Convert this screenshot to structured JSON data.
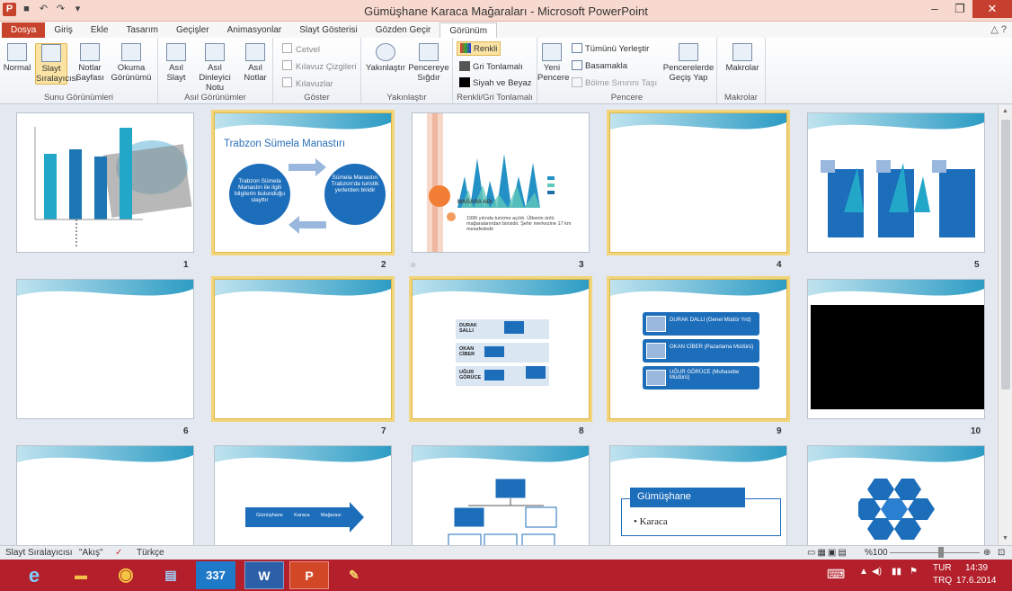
{
  "window": {
    "title": "Gümüşhane Karaca Mağaraları  -  Microsoft PowerPoint"
  },
  "qat": {
    "undo_icon": "undo-icon",
    "redo_icon": "redo-icon",
    "save_icon": "save-icon"
  },
  "tabs": [
    "Dosya",
    "Giriş",
    "Ekle",
    "Tasarım",
    "Geçişler",
    "Animasyonlar",
    "Slayt Gösterisi",
    "Gözden Geçir",
    "Görünüm"
  ],
  "ribbon": {
    "sunu": {
      "label": "Sunu Görünümleri",
      "normal": "Normal",
      "slayt": "Slayt Sıralayıcısı",
      "notlar": "Notlar Sayfası",
      "okuma": "Okuma Görünümü"
    },
    "asil": {
      "label": "Asıl Görünümler",
      "slayt": "Asıl Slayt",
      "dinleyici": "Asıl Dinleyici Notu",
      "notlar": "Asıl Notlar"
    },
    "goster": {
      "label": "Göster",
      "cetvel": "Cetvel",
      "kilavuz_cizgi": "Kılavuz Çizgileri",
      "kilavuzlar": "Kılavuzlar"
    },
    "yakinlastir": {
      "label": "Yakınlaştır",
      "btn": "Yakınlaştır",
      "sigdir": "Pencereye Sığdır"
    },
    "renk": {
      "label": "Renkli/Gri Tonlamalı",
      "renkli": "Renkli",
      "gri": "Gri Tonlamalı",
      "siyah": "Siyah ve Beyaz"
    },
    "pencere": {
      "label": "Pencere",
      "yeni": "Yeni Pencere",
      "tumunu": "Tümünü Yerleştir",
      "basamakla": "Basamakla",
      "bolme": "Bölme Sınırını Taşı",
      "gecis": "Pencerelerde Geçiş Yap"
    },
    "makrolar": {
      "label": "Makrolar",
      "btn": "Makrolar"
    }
  },
  "slides": [
    {
      "num": "1"
    },
    {
      "num": "2",
      "title": "Trabzon Sümela Manastırı",
      "left": "Trabzon Sümela Manastırı ile ilgili bilgilerin bulunduğu slayttır",
      "right": "Sümela Manastırı Trabzon'da turistik yerlerden biridir"
    },
    {
      "num": "3",
      "heading": "MAĞARA ADI",
      "text": "1996 yılında turizme açıldı. Ülkenin ünlü mağaralarından birisidir. Şehir merkezine 17 km mesafededir"
    },
    {
      "num": "4"
    },
    {
      "num": "5"
    },
    {
      "num": "6"
    },
    {
      "num": "7"
    },
    {
      "num": "8",
      "r1": "DURAK SALLI",
      "r2": "OKAN CİBER",
      "r3": "UĞUR GÖRÜCE"
    },
    {
      "num": "9",
      "b1": "DURAK DALLI (Genel Müdür Yrd)",
      "b2": "OKAN CİBER (Pazarlama Müdürü)",
      "b3": "UĞUR GÖRÜCE (Muhasebe Müdürü)"
    },
    {
      "num": "10"
    },
    {
      "num": ""
    },
    {
      "num": "",
      "arrow": "Gümüşhane        Karaca        Mağarası"
    },
    {
      "num": ""
    },
    {
      "num": "",
      "title": "Gümüşhane",
      "bullet": "Karaca"
    },
    {
      "num": ""
    }
  ],
  "status": {
    "view": "Slayt Sıralayıcısı",
    "theme": "\"Akış\"",
    "lang": "Türkçe",
    "zoom": "%100"
  },
  "taskbar": {
    "lang1": "TUR",
    "lang2": "TRQ",
    "time": "14:39",
    "date": "17.6.2014"
  },
  "colors": {
    "accent": "#c8432b",
    "taskbar": "#b3202b",
    "select": "#f2d57a",
    "blue": "#2a6fba"
  }
}
